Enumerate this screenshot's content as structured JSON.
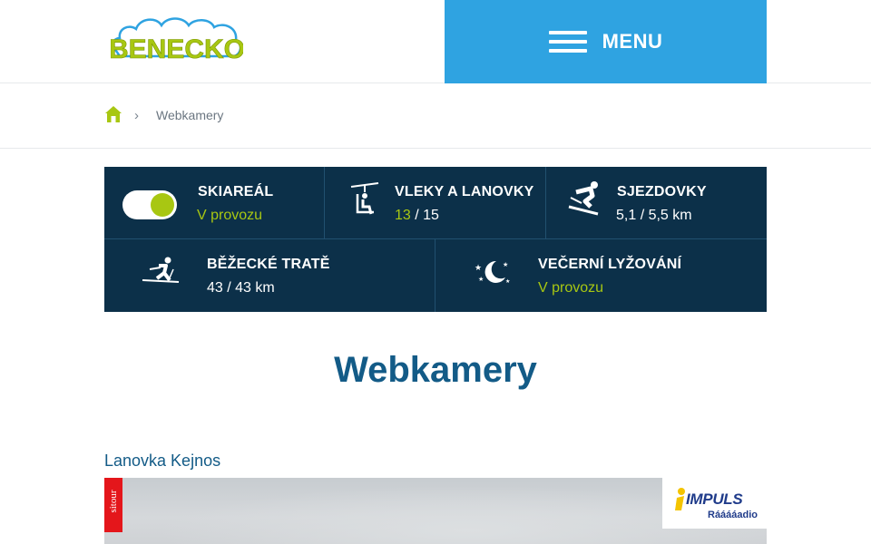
{
  "header": {
    "logo_text": "BENECKO",
    "menu_label": "MENU"
  },
  "breadcrumb": {
    "separator": "›",
    "current": "Webkamery"
  },
  "status": {
    "skiareal": {
      "title": "SKIAREÁL",
      "value": "V provozu"
    },
    "lifts": {
      "title": "VLEKY A LANOVKY",
      "open": "13",
      "total": " / 15"
    },
    "slopes": {
      "title": "SJEZDOVKY",
      "value": "5,1 / 5,5 km"
    },
    "crosscountry": {
      "title": "BĚŽECKÉ TRATĚ",
      "value": "43 / 43 km"
    },
    "night": {
      "title": "VEČERNÍ LYŽOVÁNÍ",
      "value": "V provozu"
    }
  },
  "page_title": "Webkamery",
  "webcam": {
    "title": "Lanovka Kejnos",
    "sitour_label": "sitour",
    "impuls_brand": "IMPULS",
    "impuls_sub": "Rááááadio"
  },
  "colors": {
    "menu_bg": "#2fa3e1",
    "status_bg": "#0c3049",
    "accent_green": "#a8c712",
    "title_blue": "#135b87"
  },
  "icons": {
    "home": "home-icon",
    "lift": "chairlift-icon",
    "slope": "skier-icon",
    "crosscountry": "crosscountry-skier-icon",
    "night": "moon-stars-icon"
  }
}
